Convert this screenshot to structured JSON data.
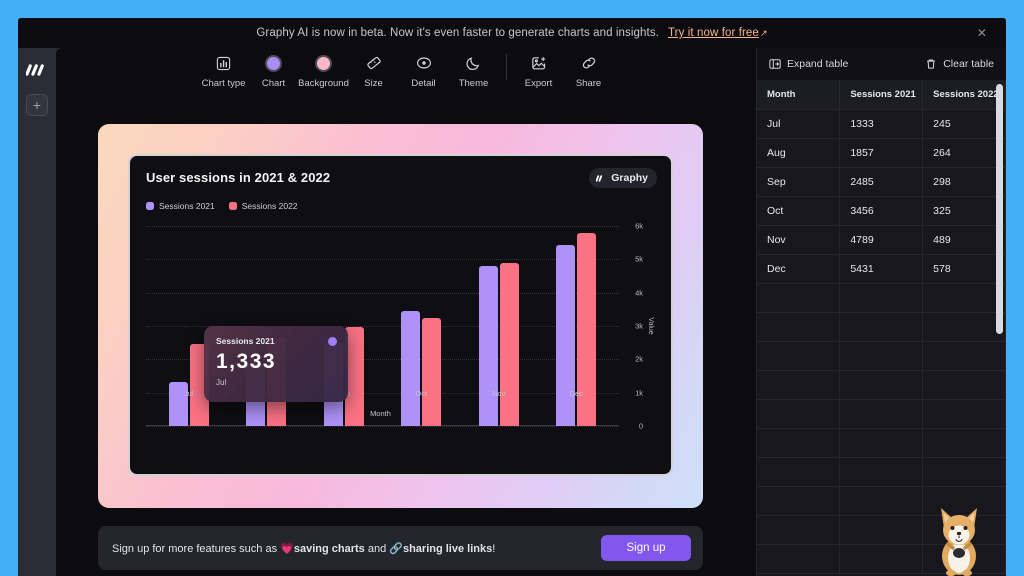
{
  "promo": {
    "message": "Graphy AI is now in beta. Now it's even faster to generate charts and insights.",
    "cta": "Try it now for free",
    "cta_arrow": "↗",
    "close": "✕"
  },
  "rail": {
    "logo_name": "Graphy",
    "add_label": "+"
  },
  "toolbar": {
    "items": [
      {
        "label": "Chart type",
        "icon": "bar-chart-icon"
      },
      {
        "label": "Chart",
        "icon": "purple-swatch-icon"
      },
      {
        "label": "Background",
        "icon": "pink-swatch-icon"
      },
      {
        "label": "Size",
        "icon": "ruler-icon"
      },
      {
        "label": "Detail",
        "icon": "target-icon"
      },
      {
        "label": "Theme",
        "icon": "moon-icon"
      },
      {
        "label": "Export",
        "icon": "image-export-icon"
      },
      {
        "label": "Share",
        "icon": "link-icon"
      }
    ]
  },
  "chart_card": {
    "title": "User sessions in 2021 & 2022",
    "watermark": "Graphy",
    "tooltip": {
      "series": "Sessions 2021",
      "value": "1,333",
      "category": "Jul"
    }
  },
  "chart_data": {
    "type": "bar",
    "title": "User sessions in 2021 & 2022",
    "xlabel": "Month",
    "ylabel": "Value",
    "categories": [
      "Jul",
      "Aug",
      "Sep",
      "Oct",
      "Nov",
      "Dec"
    ],
    "series": [
      {
        "name": "Sessions 2021",
        "color": "#ae92f9",
        "values": [
          1333,
          1857,
          2485,
          3456,
          4789,
          5431
        ]
      },
      {
        "name": "Sessions 2022",
        "color": "#fa7284",
        "values": [
          2450,
          2640,
          2980,
          3250,
          4890,
          5780
        ]
      }
    ],
    "ylim": [
      0,
      6000
    ],
    "yticks": [
      "0",
      "1k",
      "2k",
      "3k",
      "4k",
      "5k",
      "6k"
    ],
    "grid": true,
    "legend_position": "top-left"
  },
  "signup": {
    "prefix": "Sign up for more features such as ",
    "heart": "💗",
    "bold1": "saving charts",
    "middle": " and ",
    "link_icon": "🔗",
    "bold2": "sharing live links",
    "suffix": "!",
    "button": "Sign up"
  },
  "panel": {
    "expand_label": "Expand table",
    "clear_label": "Clear table",
    "columns": [
      "Month",
      "Sessions 2021",
      "Sessions 2022"
    ],
    "rows": [
      [
        "Jul",
        "1333",
        "245"
      ],
      [
        "Aug",
        "1857",
        "264"
      ],
      [
        "Sep",
        "2485",
        "298"
      ],
      [
        "Oct",
        "3456",
        "325"
      ],
      [
        "Nov",
        "4789",
        "489"
      ],
      [
        "Dec",
        "5431",
        "578"
      ]
    ],
    "empty_row_count": 10
  }
}
